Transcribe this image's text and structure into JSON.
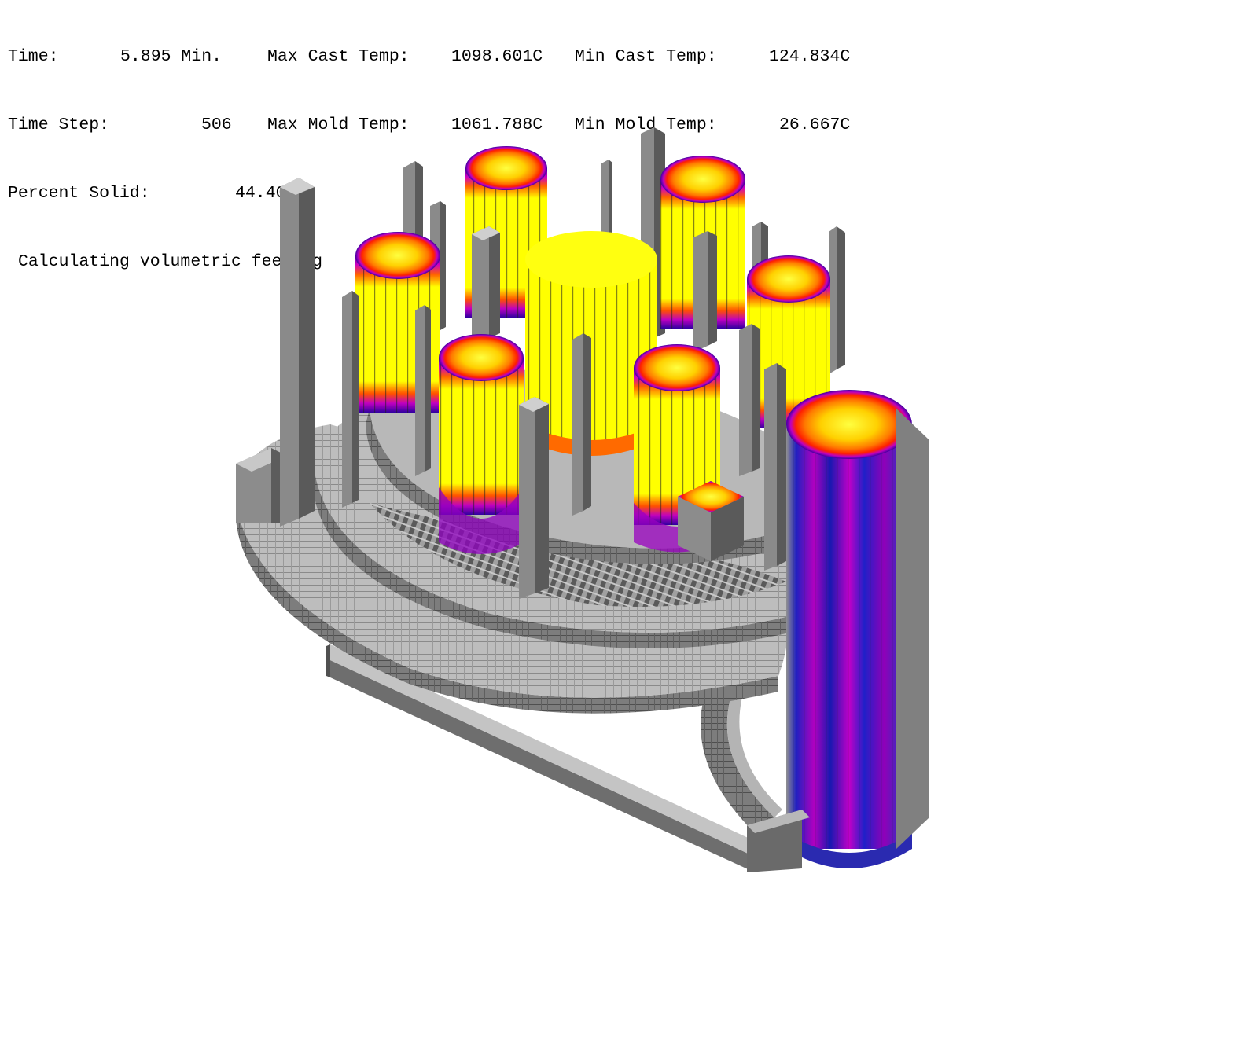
{
  "status": {
    "time_label": "Time:",
    "time_value": "5.895 Min.",
    "time_step_label": "Time Step:",
    "time_step_value": "506",
    "percent_solid_label": "Percent Solid:",
    "percent_solid_value": "44.40 %",
    "max_cast_temp_label": "Max Cast Temp:",
    "max_cast_temp_value": "1098.601C",
    "min_cast_temp_label": "Min Cast Temp:",
    "min_cast_temp_value": "124.834C",
    "max_mold_temp_label": "Max Mold Temp:",
    "max_mold_temp_value": "1061.788C",
    "min_mold_temp_label": "Min Mold Temp:",
    "min_mold_temp_value": "26.667C",
    "message": "Calculating volumetric feeding"
  },
  "colors": {
    "background": "#ffffff",
    "mold_light": "#c0c0c0",
    "mold_mid": "#a8a8a8",
    "mold_dark": "#7a7a7a",
    "mold_shadow": "#5a5a5a",
    "hot_yellow": "#ffff00",
    "hot_orange": "#ff9a00",
    "hot_red": "#ff2000",
    "warm_magenta": "#d000d0",
    "cool_blue": "#1010c0",
    "cool_purple": "#6a00b0"
  }
}
